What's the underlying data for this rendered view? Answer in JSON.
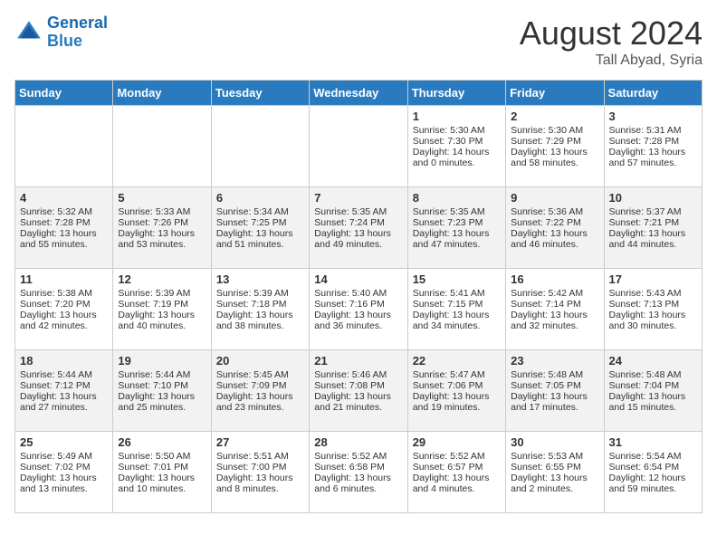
{
  "header": {
    "logo_line1": "General",
    "logo_line2": "Blue",
    "month_year": "August 2024",
    "location": "Tall Abyad, Syria"
  },
  "days_of_week": [
    "Sunday",
    "Monday",
    "Tuesday",
    "Wednesday",
    "Thursday",
    "Friday",
    "Saturday"
  ],
  "weeks": [
    [
      {
        "day": "",
        "info": ""
      },
      {
        "day": "",
        "info": ""
      },
      {
        "day": "",
        "info": ""
      },
      {
        "day": "",
        "info": ""
      },
      {
        "day": "1",
        "info": "Sunrise: 5:30 AM\nSunset: 7:30 PM\nDaylight: 14 hours\nand 0 minutes."
      },
      {
        "day": "2",
        "info": "Sunrise: 5:30 AM\nSunset: 7:29 PM\nDaylight: 13 hours\nand 58 minutes."
      },
      {
        "day": "3",
        "info": "Sunrise: 5:31 AM\nSunset: 7:28 PM\nDaylight: 13 hours\nand 57 minutes."
      }
    ],
    [
      {
        "day": "4",
        "info": "Sunrise: 5:32 AM\nSunset: 7:28 PM\nDaylight: 13 hours\nand 55 minutes."
      },
      {
        "day": "5",
        "info": "Sunrise: 5:33 AM\nSunset: 7:26 PM\nDaylight: 13 hours\nand 53 minutes."
      },
      {
        "day": "6",
        "info": "Sunrise: 5:34 AM\nSunset: 7:25 PM\nDaylight: 13 hours\nand 51 minutes."
      },
      {
        "day": "7",
        "info": "Sunrise: 5:35 AM\nSunset: 7:24 PM\nDaylight: 13 hours\nand 49 minutes."
      },
      {
        "day": "8",
        "info": "Sunrise: 5:35 AM\nSunset: 7:23 PM\nDaylight: 13 hours\nand 47 minutes."
      },
      {
        "day": "9",
        "info": "Sunrise: 5:36 AM\nSunset: 7:22 PM\nDaylight: 13 hours\nand 46 minutes."
      },
      {
        "day": "10",
        "info": "Sunrise: 5:37 AM\nSunset: 7:21 PM\nDaylight: 13 hours\nand 44 minutes."
      }
    ],
    [
      {
        "day": "11",
        "info": "Sunrise: 5:38 AM\nSunset: 7:20 PM\nDaylight: 13 hours\nand 42 minutes."
      },
      {
        "day": "12",
        "info": "Sunrise: 5:39 AM\nSunset: 7:19 PM\nDaylight: 13 hours\nand 40 minutes."
      },
      {
        "day": "13",
        "info": "Sunrise: 5:39 AM\nSunset: 7:18 PM\nDaylight: 13 hours\nand 38 minutes."
      },
      {
        "day": "14",
        "info": "Sunrise: 5:40 AM\nSunset: 7:16 PM\nDaylight: 13 hours\nand 36 minutes."
      },
      {
        "day": "15",
        "info": "Sunrise: 5:41 AM\nSunset: 7:15 PM\nDaylight: 13 hours\nand 34 minutes."
      },
      {
        "day": "16",
        "info": "Sunrise: 5:42 AM\nSunset: 7:14 PM\nDaylight: 13 hours\nand 32 minutes."
      },
      {
        "day": "17",
        "info": "Sunrise: 5:43 AM\nSunset: 7:13 PM\nDaylight: 13 hours\nand 30 minutes."
      }
    ],
    [
      {
        "day": "18",
        "info": "Sunrise: 5:44 AM\nSunset: 7:12 PM\nDaylight: 13 hours\nand 27 minutes."
      },
      {
        "day": "19",
        "info": "Sunrise: 5:44 AM\nSunset: 7:10 PM\nDaylight: 13 hours\nand 25 minutes."
      },
      {
        "day": "20",
        "info": "Sunrise: 5:45 AM\nSunset: 7:09 PM\nDaylight: 13 hours\nand 23 minutes."
      },
      {
        "day": "21",
        "info": "Sunrise: 5:46 AM\nSunset: 7:08 PM\nDaylight: 13 hours\nand 21 minutes."
      },
      {
        "day": "22",
        "info": "Sunrise: 5:47 AM\nSunset: 7:06 PM\nDaylight: 13 hours\nand 19 minutes."
      },
      {
        "day": "23",
        "info": "Sunrise: 5:48 AM\nSunset: 7:05 PM\nDaylight: 13 hours\nand 17 minutes."
      },
      {
        "day": "24",
        "info": "Sunrise: 5:48 AM\nSunset: 7:04 PM\nDaylight: 13 hours\nand 15 minutes."
      }
    ],
    [
      {
        "day": "25",
        "info": "Sunrise: 5:49 AM\nSunset: 7:02 PM\nDaylight: 13 hours\nand 13 minutes."
      },
      {
        "day": "26",
        "info": "Sunrise: 5:50 AM\nSunset: 7:01 PM\nDaylight: 13 hours\nand 10 minutes."
      },
      {
        "day": "27",
        "info": "Sunrise: 5:51 AM\nSunset: 7:00 PM\nDaylight: 13 hours\nand 8 minutes."
      },
      {
        "day": "28",
        "info": "Sunrise: 5:52 AM\nSunset: 6:58 PM\nDaylight: 13 hours\nand 6 minutes."
      },
      {
        "day": "29",
        "info": "Sunrise: 5:52 AM\nSunset: 6:57 PM\nDaylight: 13 hours\nand 4 minutes."
      },
      {
        "day": "30",
        "info": "Sunrise: 5:53 AM\nSunset: 6:55 PM\nDaylight: 13 hours\nand 2 minutes."
      },
      {
        "day": "31",
        "info": "Sunrise: 5:54 AM\nSunset: 6:54 PM\nDaylight: 12 hours\nand 59 minutes."
      }
    ]
  ]
}
